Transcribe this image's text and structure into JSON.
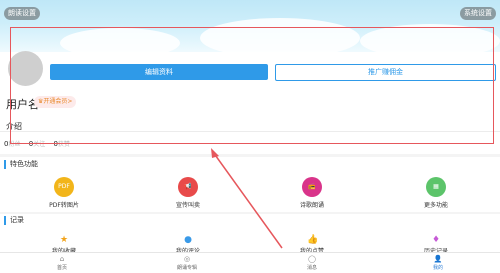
{
  "header": {
    "left_button": "朗读设置",
    "right_button": "系统设置"
  },
  "profile": {
    "edit_button": "编辑资料",
    "promo_button": "推广赚佣金",
    "username": "用户名",
    "vip_badge": "开通会员>",
    "intro_label": "介绍",
    "stats": [
      {
        "value": "0",
        "label": "粉丝"
      },
      {
        "value": "0",
        "label": "关注"
      },
      {
        "value": "0",
        "label": "获赞"
      }
    ]
  },
  "features": {
    "title": "特色功能",
    "items": [
      {
        "label": "PDF转图片",
        "icon": "pdf-icon",
        "icon_text": "PDF",
        "color": "#f2b51a"
      },
      {
        "label": "宣传叫卖",
        "icon": "megaphone-icon",
        "icon_text": "📢",
        "color": "#e84a4a"
      },
      {
        "label": "诗歌朗诵",
        "icon": "radio-icon",
        "icon_text": "📻",
        "color": "#d9348a"
      },
      {
        "label": "更多功能",
        "icon": "grid-icon",
        "icon_text": "▦",
        "color": "#5cc46a"
      }
    ]
  },
  "records": {
    "title": "记录",
    "items": [
      {
        "label": "我的收藏",
        "icon": "star-icon",
        "icon_text": "★",
        "color": "#f2a31a"
      },
      {
        "label": "我的评论",
        "icon": "comment-icon",
        "icon_text": "●",
        "color": "#3a9ae8"
      },
      {
        "label": "我的点赞",
        "icon": "thumb-icon",
        "icon_text": "👍",
        "color": "#f07a3a"
      },
      {
        "label": "历史记录",
        "icon": "history-icon",
        "icon_text": "♦",
        "color": "#c65ad6"
      }
    ]
  },
  "tabbar": {
    "items": [
      {
        "label": "首页",
        "icon": "home-icon",
        "icon_text": "⌂"
      },
      {
        "label": "朗诵专辑",
        "icon": "album-icon",
        "icon_text": "◎"
      },
      {
        "label": "消息",
        "icon": "message-icon",
        "icon_text": "◯"
      },
      {
        "label": "我的",
        "icon": "user-icon",
        "icon_text": "👤"
      }
    ],
    "active_index": 3
  },
  "colors": {
    "accent": "#2f9ae8",
    "highlight_frame": "#e6575c"
  }
}
